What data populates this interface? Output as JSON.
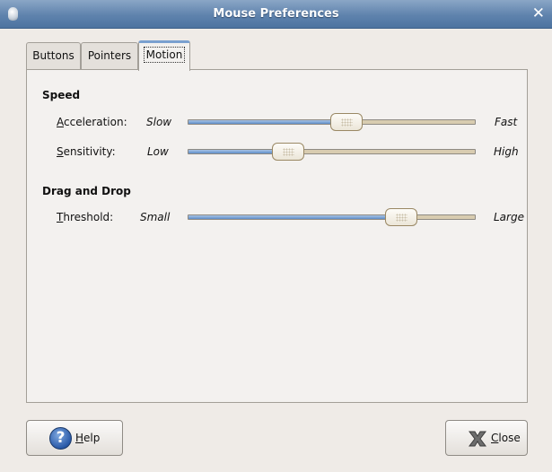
{
  "window": {
    "title": "Mouse Preferences"
  },
  "tabs": [
    {
      "label": "Buttons",
      "active": false
    },
    {
      "label": "Pointers",
      "active": false
    },
    {
      "label": "Motion",
      "active": true
    }
  ],
  "speed": {
    "title": "Speed",
    "acceleration": {
      "mnemonic": "A",
      "rest": "cceleration:",
      "min": "Slow",
      "max": "Fast",
      "value": 0.55
    },
    "sensitivity": {
      "mnemonic": "S",
      "rest": "ensitivity:",
      "min": "Low",
      "max": "High",
      "value": 0.35
    }
  },
  "drag_and_drop": {
    "title": "Drag and Drop",
    "threshold": {
      "mnemonic": "T",
      "rest": "hreshold:",
      "min": "Small",
      "max": "Large",
      "value": 0.74
    }
  },
  "buttons": {
    "help": {
      "mnemonic": "H",
      "rest": "elp"
    },
    "close": {
      "mnemonic": "C",
      "rest": "lose"
    }
  },
  "icons": {
    "help": "help-icon",
    "close": "close-icon",
    "app": "mouse-icon"
  }
}
